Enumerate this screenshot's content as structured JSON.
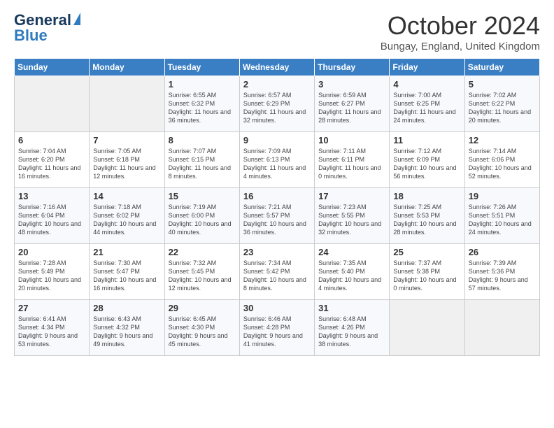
{
  "header": {
    "logo_general": "General",
    "logo_blue": "Blue",
    "month_title": "October 2024",
    "location": "Bungay, England, United Kingdom"
  },
  "days_of_week": [
    "Sunday",
    "Monday",
    "Tuesday",
    "Wednesday",
    "Thursday",
    "Friday",
    "Saturday"
  ],
  "weeks": [
    [
      {
        "day": "",
        "sunrise": "",
        "sunset": "",
        "daylight": ""
      },
      {
        "day": "",
        "sunrise": "",
        "sunset": "",
        "daylight": ""
      },
      {
        "day": "1",
        "sunrise": "Sunrise: 6:55 AM",
        "sunset": "Sunset: 6:32 PM",
        "daylight": "Daylight: 11 hours and 36 minutes."
      },
      {
        "day": "2",
        "sunrise": "Sunrise: 6:57 AM",
        "sunset": "Sunset: 6:29 PM",
        "daylight": "Daylight: 11 hours and 32 minutes."
      },
      {
        "day": "3",
        "sunrise": "Sunrise: 6:59 AM",
        "sunset": "Sunset: 6:27 PM",
        "daylight": "Daylight: 11 hours and 28 minutes."
      },
      {
        "day": "4",
        "sunrise": "Sunrise: 7:00 AM",
        "sunset": "Sunset: 6:25 PM",
        "daylight": "Daylight: 11 hours and 24 minutes."
      },
      {
        "day": "5",
        "sunrise": "Sunrise: 7:02 AM",
        "sunset": "Sunset: 6:22 PM",
        "daylight": "Daylight: 11 hours and 20 minutes."
      }
    ],
    [
      {
        "day": "6",
        "sunrise": "Sunrise: 7:04 AM",
        "sunset": "Sunset: 6:20 PM",
        "daylight": "Daylight: 11 hours and 16 minutes."
      },
      {
        "day": "7",
        "sunrise": "Sunrise: 7:05 AM",
        "sunset": "Sunset: 6:18 PM",
        "daylight": "Daylight: 11 hours and 12 minutes."
      },
      {
        "day": "8",
        "sunrise": "Sunrise: 7:07 AM",
        "sunset": "Sunset: 6:15 PM",
        "daylight": "Daylight: 11 hours and 8 minutes."
      },
      {
        "day": "9",
        "sunrise": "Sunrise: 7:09 AM",
        "sunset": "Sunset: 6:13 PM",
        "daylight": "Daylight: 11 hours and 4 minutes."
      },
      {
        "day": "10",
        "sunrise": "Sunrise: 7:11 AM",
        "sunset": "Sunset: 6:11 PM",
        "daylight": "Daylight: 11 hours and 0 minutes."
      },
      {
        "day": "11",
        "sunrise": "Sunrise: 7:12 AM",
        "sunset": "Sunset: 6:09 PM",
        "daylight": "Daylight: 10 hours and 56 minutes."
      },
      {
        "day": "12",
        "sunrise": "Sunrise: 7:14 AM",
        "sunset": "Sunset: 6:06 PM",
        "daylight": "Daylight: 10 hours and 52 minutes."
      }
    ],
    [
      {
        "day": "13",
        "sunrise": "Sunrise: 7:16 AM",
        "sunset": "Sunset: 6:04 PM",
        "daylight": "Daylight: 10 hours and 48 minutes."
      },
      {
        "day": "14",
        "sunrise": "Sunrise: 7:18 AM",
        "sunset": "Sunset: 6:02 PM",
        "daylight": "Daylight: 10 hours and 44 minutes."
      },
      {
        "day": "15",
        "sunrise": "Sunrise: 7:19 AM",
        "sunset": "Sunset: 6:00 PM",
        "daylight": "Daylight: 10 hours and 40 minutes."
      },
      {
        "day": "16",
        "sunrise": "Sunrise: 7:21 AM",
        "sunset": "Sunset: 5:57 PM",
        "daylight": "Daylight: 10 hours and 36 minutes."
      },
      {
        "day": "17",
        "sunrise": "Sunrise: 7:23 AM",
        "sunset": "Sunset: 5:55 PM",
        "daylight": "Daylight: 10 hours and 32 minutes."
      },
      {
        "day": "18",
        "sunrise": "Sunrise: 7:25 AM",
        "sunset": "Sunset: 5:53 PM",
        "daylight": "Daylight: 10 hours and 28 minutes."
      },
      {
        "day": "19",
        "sunrise": "Sunrise: 7:26 AM",
        "sunset": "Sunset: 5:51 PM",
        "daylight": "Daylight: 10 hours and 24 minutes."
      }
    ],
    [
      {
        "day": "20",
        "sunrise": "Sunrise: 7:28 AM",
        "sunset": "Sunset: 5:49 PM",
        "daylight": "Daylight: 10 hours and 20 minutes."
      },
      {
        "day": "21",
        "sunrise": "Sunrise: 7:30 AM",
        "sunset": "Sunset: 5:47 PM",
        "daylight": "Daylight: 10 hours and 16 minutes."
      },
      {
        "day": "22",
        "sunrise": "Sunrise: 7:32 AM",
        "sunset": "Sunset: 5:45 PM",
        "daylight": "Daylight: 10 hours and 12 minutes."
      },
      {
        "day": "23",
        "sunrise": "Sunrise: 7:34 AM",
        "sunset": "Sunset: 5:42 PM",
        "daylight": "Daylight: 10 hours and 8 minutes."
      },
      {
        "day": "24",
        "sunrise": "Sunrise: 7:35 AM",
        "sunset": "Sunset: 5:40 PM",
        "daylight": "Daylight: 10 hours and 4 minutes."
      },
      {
        "day": "25",
        "sunrise": "Sunrise: 7:37 AM",
        "sunset": "Sunset: 5:38 PM",
        "daylight": "Daylight: 10 hours and 0 minutes."
      },
      {
        "day": "26",
        "sunrise": "Sunrise: 7:39 AM",
        "sunset": "Sunset: 5:36 PM",
        "daylight": "Daylight: 9 hours and 57 minutes."
      }
    ],
    [
      {
        "day": "27",
        "sunrise": "Sunrise: 6:41 AM",
        "sunset": "Sunset: 4:34 PM",
        "daylight": "Daylight: 9 hours and 53 minutes."
      },
      {
        "day": "28",
        "sunrise": "Sunrise: 6:43 AM",
        "sunset": "Sunset: 4:32 PM",
        "daylight": "Daylight: 9 hours and 49 minutes."
      },
      {
        "day": "29",
        "sunrise": "Sunrise: 6:45 AM",
        "sunset": "Sunset: 4:30 PM",
        "daylight": "Daylight: 9 hours and 45 minutes."
      },
      {
        "day": "30",
        "sunrise": "Sunrise: 6:46 AM",
        "sunset": "Sunset: 4:28 PM",
        "daylight": "Daylight: 9 hours and 41 minutes."
      },
      {
        "day": "31",
        "sunrise": "Sunrise: 6:48 AM",
        "sunset": "Sunset: 4:26 PM",
        "daylight": "Daylight: 9 hours and 38 minutes."
      },
      {
        "day": "",
        "sunrise": "",
        "sunset": "",
        "daylight": ""
      },
      {
        "day": "",
        "sunrise": "",
        "sunset": "",
        "daylight": ""
      }
    ]
  ]
}
